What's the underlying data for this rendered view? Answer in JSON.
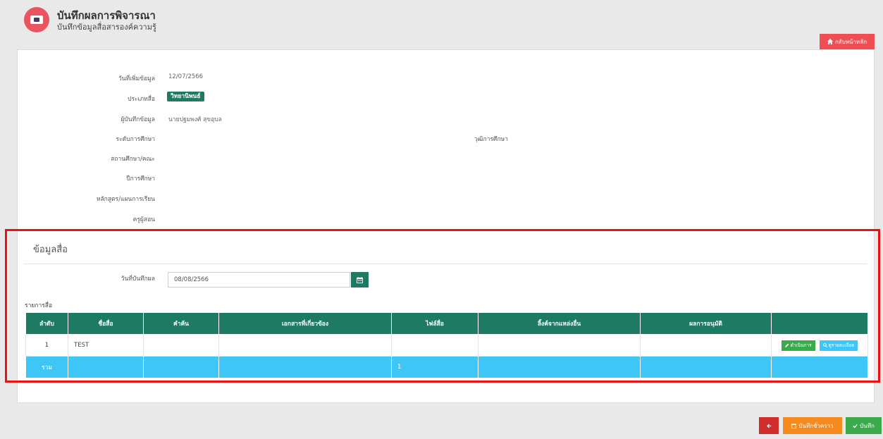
{
  "header": {
    "title": "บันทึกผลการพิจารณา",
    "subtitle": "บันทึกข้อมูลสื่อสารองค์ความรู้",
    "icon": "monitor-icon"
  },
  "home_button": {
    "label": "กลับหน้าหลัก",
    "icon": "home-icon"
  },
  "info": {
    "date_added_label": "วันที่เพิ่มข้อมูล",
    "date_added_value": "12/07/2566",
    "media_type_label": "ประเภทสื่อ",
    "media_type_value": "วิทยานิพนธ์",
    "recorder_label": "ผู้บันทึกข้อมูล",
    "recorder_value": "นายปฐมพงศ์ สุขอุบล",
    "edu_level_label": "ระดับการศึกษา",
    "degree_label": "วุฒิการศึกษา",
    "institution_label": "สถานศึกษา/คณะ",
    "year_label": "ปีการศึกษา",
    "curriculum_label": "หลักสูตร/แผนการเรียน",
    "teacher_label": "ครูผู้สอน"
  },
  "media_section": {
    "title": "ข้อมูลสื่อ",
    "record_date_label": "วันที่บันทึกผล",
    "record_date_value": "08/08/2566",
    "list_label": "รายการสื่อ"
  },
  "table": {
    "headers": [
      "ลำดับ",
      "ชื่อสื่อ",
      "คำค้น",
      "เอกสารที่เกี่ยวข้อง",
      "ไฟล์สื่อ",
      "ลิ้งค์จากแหล่งอื่น",
      "ผลการอนุมัติ",
      ""
    ],
    "rows": [
      {
        "no": "1",
        "name": "TEST",
        "keyword": "",
        "documents": "",
        "file": "",
        "link": "",
        "approval": ""
      }
    ],
    "actions": {
      "edit_label": "ดำเนินการ",
      "view_label": "ดูรายละเอียด"
    },
    "total": {
      "label": "รวม",
      "file_count": "1"
    }
  },
  "footer": {
    "back_icon": "arrow-left-icon",
    "draft_label": "บันทึกชั่วคราว",
    "save_label": "บันทึก"
  },
  "colors": {
    "primary_green": "#1e7a62",
    "header_icon": "#e9545f",
    "home_button": "#f04e55",
    "total_row": "#3ec6f7",
    "highlight": "#ee1111"
  }
}
